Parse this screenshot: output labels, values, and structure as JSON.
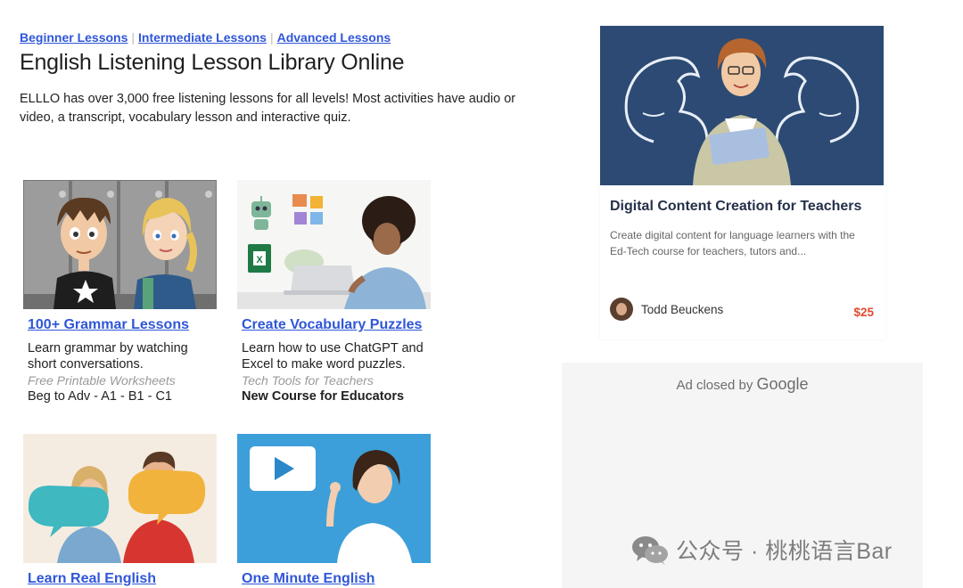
{
  "nav": {
    "links": [
      "Beginner Lessons",
      "Intermediate Lessons",
      "Advanced Lessons"
    ],
    "separator": "|"
  },
  "header": {
    "title": "English Listening Lesson Library Online",
    "intro": "ELLLO has over 3,000 free listening lessons for all levels! Most activities have audio or video, a transcript, vocabulary lesson and interactive quiz."
  },
  "cards": [
    {
      "image_icon": "cartoon-students-lockers",
      "link": "100+ Grammar Lessons",
      "text": "Learn grammar by watching short conversations.",
      "sub": "Free Printable Worksheets",
      "level": "Beg to Adv - A1 - B1 - C1"
    },
    {
      "image_icon": "student-laptop-puzzles",
      "link": "Create Vocabulary Puzzles",
      "text": "Learn how to use ChatGPT and Excel to make word puzzles.",
      "sub": "Tech Tools for Teachers",
      "level": "New Course for Educators"
    },
    {
      "image_icon": "two-people-speech-bubbles",
      "link": "Learn Real English"
    },
    {
      "image_icon": "woman-video-play-icon",
      "link": "One Minute English"
    }
  ],
  "promo": {
    "image_icon": "teacher-chalkboard-muscles",
    "title": "Digital Content Creation for Teachers",
    "description": "Create digital content for language learners with the Ed-Tech course for teachers, tutors and...",
    "author": "Todd Beuckens",
    "price": "$25"
  },
  "ad": {
    "label": "Ad closed by",
    "brand": "Google"
  },
  "watermark": {
    "text": "公众号 · 桃桃语言Bar"
  },
  "colors": {
    "link": "#2f56d8",
    "price": "#e2492f",
    "promo_bg": "#2c4a73"
  }
}
